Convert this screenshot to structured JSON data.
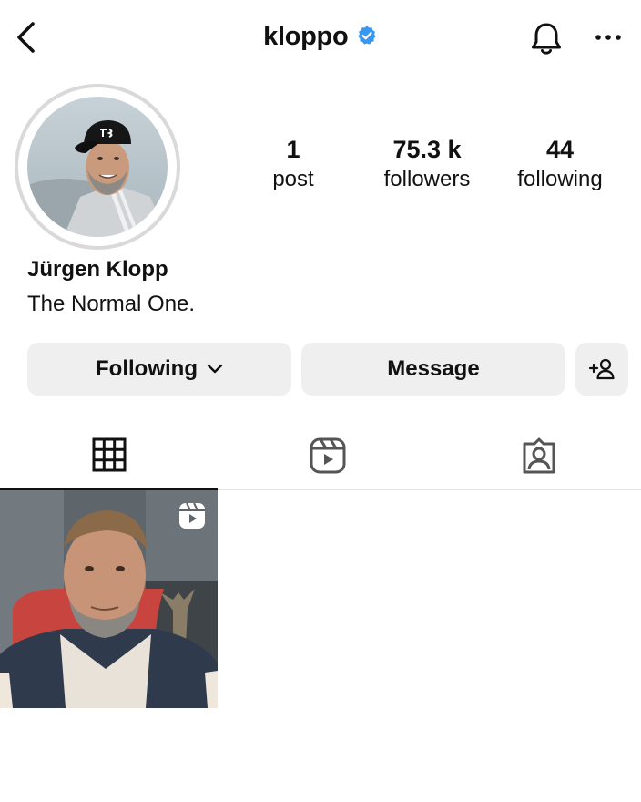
{
  "header": {
    "username": "kloppo",
    "icons": [
      "chevron-left-icon",
      "verified-badge-icon",
      "bell-icon",
      "more-horizontal-icon"
    ]
  },
  "profile": {
    "full_name": "Jürgen Klopp",
    "bio": "The Normal One.",
    "stats": {
      "posts": {
        "value": "1",
        "label": "post"
      },
      "followers": {
        "value": "75.3 k",
        "label": "followers"
      },
      "following": {
        "value": "44",
        "label": "following"
      }
    }
  },
  "actions": {
    "following_label": "Following",
    "message_label": "Message",
    "add_user_icon": "add-person-icon"
  },
  "tabs": [
    {
      "name": "posts-grid",
      "icon": "grid-icon",
      "active": true
    },
    {
      "name": "reels",
      "icon": "reels-icon",
      "active": false
    },
    {
      "name": "tagged",
      "icon": "tagged-person-icon",
      "active": false
    }
  ],
  "posts": [
    {
      "type": "reel",
      "icon": "reel-badge-icon"
    }
  ],
  "colors": {
    "verified_blue": "#3897f0",
    "button_gray": "#efefef",
    "ring_gray": "#d9d9d9",
    "text": "#111111"
  }
}
